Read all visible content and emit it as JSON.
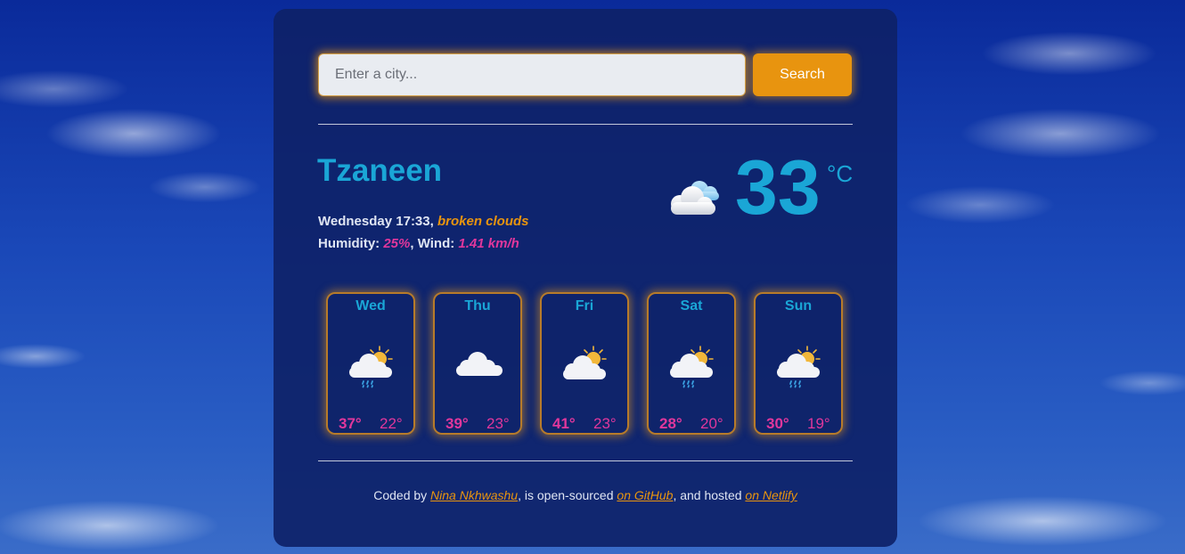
{
  "search": {
    "placeholder": "Enter a city...",
    "value": "",
    "button_label": "Search"
  },
  "current": {
    "city": "Tzaneen",
    "day_time": "Wednesday 17:33",
    "separator": ", ",
    "description": "broken clouds",
    "humidity_label": "Humidity: ",
    "humidity": "25%",
    "wind_label": ", Wind: ",
    "wind": "1.41 km/h",
    "temperature": "33",
    "unit": "°C",
    "icon": "broken-clouds-icon"
  },
  "forecast": [
    {
      "day": "Wed",
      "icon": "sun-cloud-rain-icon",
      "max": "37°",
      "min": "22°"
    },
    {
      "day": "Thu",
      "icon": "cloud-icon",
      "max": "39°",
      "min": "23°"
    },
    {
      "day": "Fri",
      "icon": "sun-cloud-icon",
      "max": "41°",
      "min": "23°"
    },
    {
      "day": "Sat",
      "icon": "sun-cloud-rain-icon",
      "max": "28°",
      "min": "20°"
    },
    {
      "day": "Sun",
      "icon": "sun-cloud-rain-icon",
      "max": "30°",
      "min": "19°"
    }
  ],
  "footer": {
    "prefix": "Coded by ",
    "author": "Nina Nkhwashu",
    "middle": ", is open-sourced ",
    "github": "on GitHub",
    "middle2": ", and hosted ",
    "netlify": "on Netlify"
  },
  "colors": {
    "accent": "#e8940f",
    "primary": "#1aa6d6",
    "highlight": "#e1379c",
    "card": "#0e2268"
  }
}
